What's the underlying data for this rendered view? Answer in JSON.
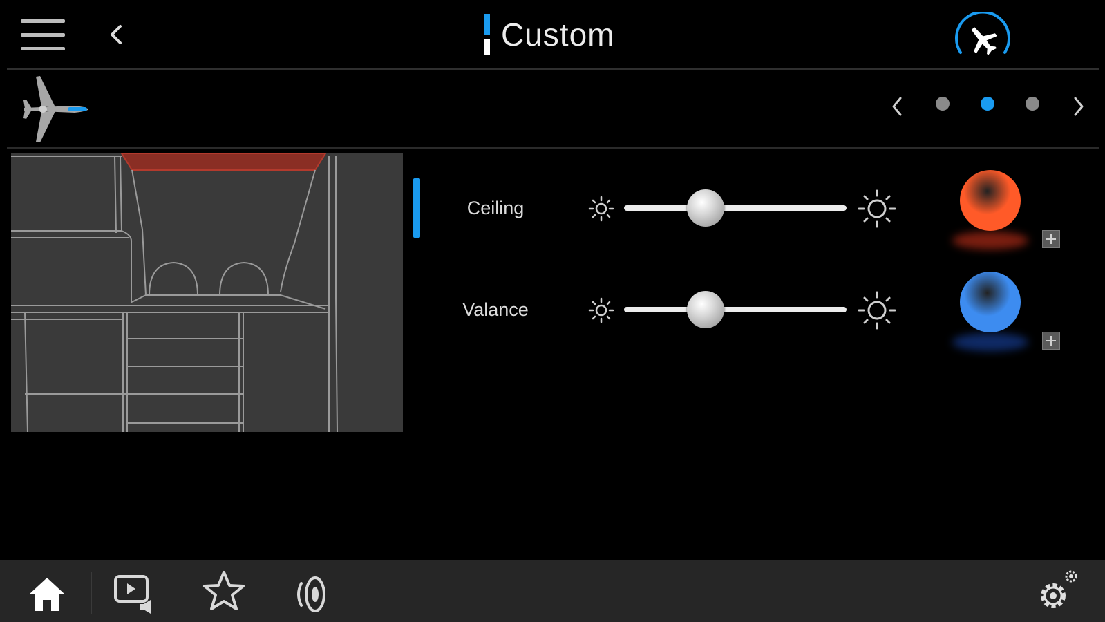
{
  "header": {
    "title": "Custom",
    "menu_icon": "hamburger-menu-icon",
    "back_icon": "chevron-left-icon",
    "flight_icon": "airplane-circle-icon"
  },
  "aircraft_bar": {
    "aircraft_icon": "aircraft-top-view-icon",
    "pager": {
      "count": 3,
      "active_index": 1
    }
  },
  "controls": [
    {
      "label": "Ceiling",
      "brightness": 0.33,
      "color": "#ff5a28"
    },
    {
      "label": "Valance",
      "brightness": 0.33,
      "color": "#3d8cf0"
    }
  ],
  "toolbar": {
    "items": [
      "home-icon",
      "media-icon",
      "favorites-icon",
      "audio-icon"
    ],
    "settings_icon": "settings-icon"
  },
  "colors": {
    "accent": "#1a9bf0",
    "background": "#000000",
    "toolbar": "#262626"
  }
}
